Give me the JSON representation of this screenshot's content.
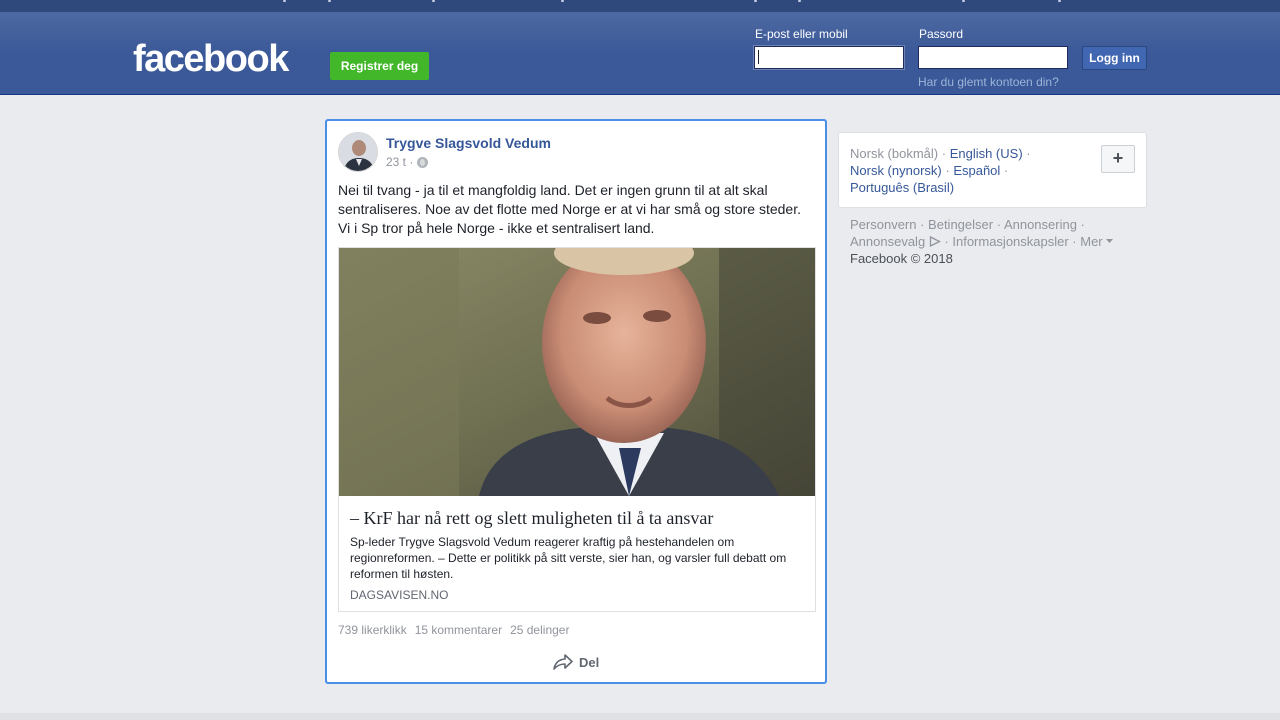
{
  "header": {
    "logo": "facebook",
    "register_label": "Registrer deg",
    "email_label": "E-post eller mobil",
    "email_value": "",
    "password_label": "Passord",
    "password_value": "",
    "login_label": "Logg inn",
    "forgot_label": "Har du glemt kontoen din?"
  },
  "post": {
    "author": "Trygve Slagsvold Vedum",
    "time": "23 t ·",
    "privacy_icon": "globe-icon",
    "text": "Nei til tvang - ja til et mangfoldig land. Det er ingen grunn til at alt skal sentraliseres. Noe av det flotte med Norge er at vi har små og store steder. Vi i Sp tror på hele Norge - ikke et sentralisert land.",
    "link": {
      "title": "– KrF har nå rett og slett muligheten til å ta ansvar",
      "description": "Sp-leder Trygve Slagsvold Vedum reagerer kraftig på hestehandelen om regionreformen. – Dette er politikk på sitt verste, sier han, og varsler full debatt om reformen til høsten.",
      "domain": "DAGSAVISEN.NO"
    },
    "likes": "739 likerklikk",
    "comments": "15 kommentarer",
    "shares": "25 delinger",
    "share_label": "Del"
  },
  "languages": {
    "current": "Norsk (bokmål)",
    "sep": " · ",
    "options": [
      "English (US)",
      "Norsk (nynorsk)",
      "Español",
      "Português (Brasil)"
    ],
    "add_label": "+"
  },
  "footer": {
    "links": [
      "Personvern",
      "Betingelser",
      "Annonsering",
      "Annonsevalg",
      "Informasjonskapsler",
      "Mer"
    ],
    "copyright": "Facebook © 2018"
  },
  "colors": {
    "brand": "#3b5998",
    "register": "#42b72a",
    "link": "#365899",
    "focus_border": "#4a8ee8"
  }
}
